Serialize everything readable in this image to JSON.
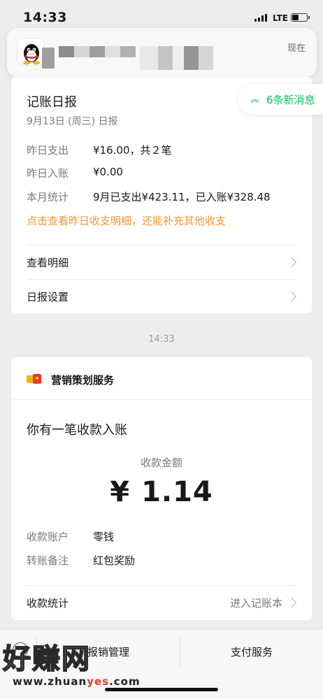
{
  "status_bar": {
    "time": "14:33",
    "network": "LTE"
  },
  "notification": {
    "time": "现在"
  },
  "new_messages": {
    "label": "6条新消息"
  },
  "daily_report": {
    "title": "记账日报",
    "date": "9月13日 (周三) 日报",
    "rows": [
      {
        "label": "昨日支出",
        "value": "¥16.00，共２笔"
      },
      {
        "label": "昨日入账",
        "value": "¥0.00"
      },
      {
        "label": "本月统计",
        "value": "9月已支出¥423.11，已入账¥328.48"
      }
    ],
    "hint": "点击查看昨日收支明细，还能补充其他收支",
    "menu": [
      {
        "label": "查看明细"
      },
      {
        "label": "日报设置"
      }
    ]
  },
  "timestamp": "14:33",
  "receipt": {
    "service_name": "营销策划服务",
    "message": "你有一笔收款入账",
    "amount_label": "收款金额",
    "currency": "¥",
    "amount": "1.14",
    "rows": [
      {
        "label": "收款账户",
        "value": "零钱"
      },
      {
        "label": "转账备注",
        "value": "红包奖励"
      }
    ],
    "stats_label": "收款统计",
    "stats_link": "进入记账本"
  },
  "bottom_bar": {
    "left_label": "报销管理",
    "right_label": "支付服务"
  },
  "watermark": {
    "text": "好赚网",
    "url_prefix": "www.zhuan",
    "url_highlight": "yes",
    "url_suffix": ".com"
  }
}
